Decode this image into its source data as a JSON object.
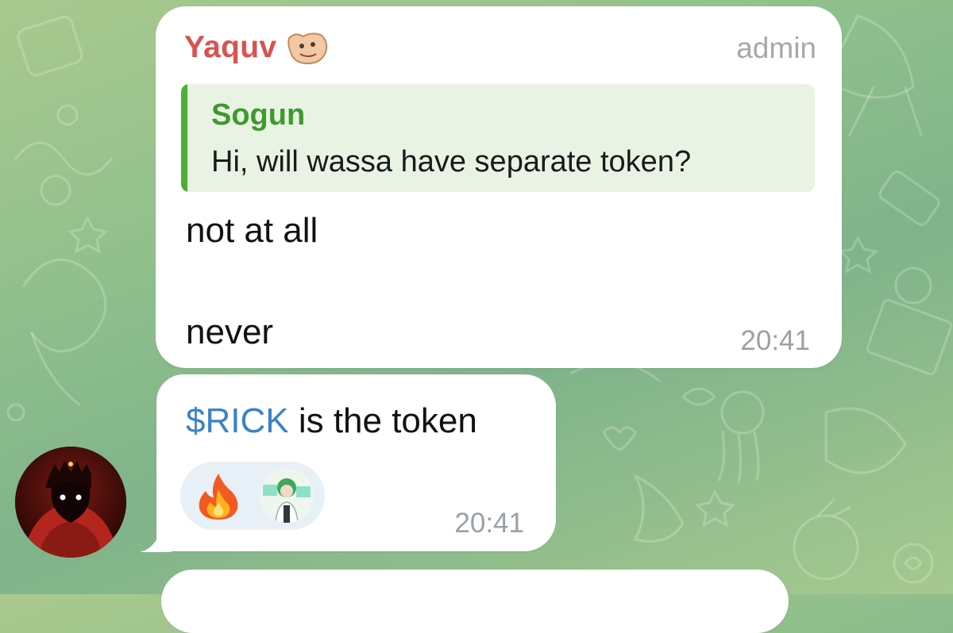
{
  "messages": [
    {
      "sender": "Yaquv",
      "role": "admin",
      "reply": {
        "author": "Sogun",
        "text": "Hi, will wassa have separate token?"
      },
      "line1": "not at all",
      "line2": "never",
      "time": "20:41"
    },
    {
      "ticker": "$RICK",
      "text": " is the token",
      "time": "20:41",
      "reactions": [
        {
          "type": "emoji",
          "icon": "fire-icon"
        },
        {
          "type": "user-avatar",
          "icon": "reactor-avatar"
        }
      ]
    }
  ],
  "colors": {
    "sender_name": "#d9534f",
    "reply_accent": "#4caf36",
    "ticker_link": "#3a83c7",
    "timestamp": "#9aa1a6"
  }
}
